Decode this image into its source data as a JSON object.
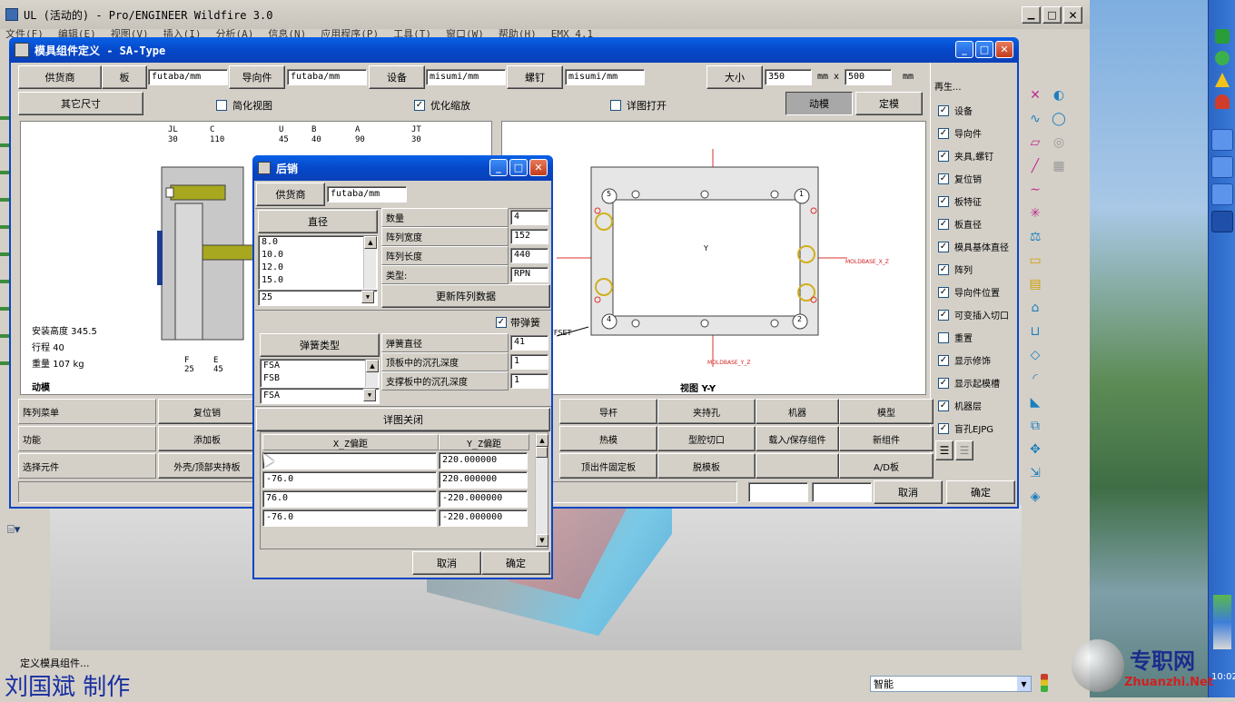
{
  "app": {
    "title": "UL (活动的) - Pro/ENGINEER Wildfire 3.0",
    "menu": [
      "文件(F)",
      "编辑(E)",
      "视图(V)",
      "插入(I)",
      "分析(A)",
      "信息(N)",
      "应用程序(P)",
      "工具(T)",
      "窗口(W)",
      "帮助(H)",
      "EMX 4.1"
    ],
    "status": "定义模具组件...",
    "smart": "智能"
  },
  "watermark": {
    "author": "刘国斌 制作",
    "site_cn": "专职网",
    "site_en": "Zhuanzhi.Net",
    "clock": "10:02"
  },
  "mold_dialog": {
    "title": "模具组件定义 - SA-Type",
    "row1": {
      "supplier_btn": "供货商",
      "plate_btn": "板",
      "plate_val": "futaba/mm",
      "guide_btn": "导向件",
      "guide_val": "futaba/mm",
      "equip_btn": "设备",
      "equip_val": "misumi/mm",
      "screw_btn": "螺钉",
      "screw_val": "misumi/mm",
      "size_btn": "大小",
      "size_w": "350",
      "mm_x": "mm x",
      "size_h": "500",
      "mm": "mm"
    },
    "row2": {
      "other_btn": "其它尺寸",
      "simplified": "简化视图",
      "optimize": "优化缩放",
      "detail_open": "详图打开",
      "moving_btn": "动模",
      "fixed_btn": "定模"
    },
    "left_view": {
      "labels_top": [
        "JL",
        "C",
        "U",
        "B",
        "A",
        "JT"
      ],
      "values_top": [
        "30",
        "110",
        "45",
        "40",
        "90",
        "30"
      ],
      "install_h": "安装高度  345.5",
      "stroke": "行程  40",
      "weight": "重量  107 kg",
      "bot_labels": [
        "F",
        "E"
      ],
      "bot_values": [
        "25",
        "45"
      ],
      "caption": "动模"
    },
    "right_view": {
      "caption": "视图 Y-Y",
      "xlabel": "MOLDBASE_X_Z",
      "ylabel": "MOLDBASE_Y_Z",
      "offset": "OFFSET",
      "circles": [
        "5",
        "1",
        "4",
        "2"
      ]
    },
    "regen": {
      "title": "再生...",
      "items": [
        {
          "label": "设备",
          "checked": true
        },
        {
          "label": "导向件",
          "checked": true
        },
        {
          "label": "夹具,螺钉",
          "checked": true
        },
        {
          "label": "复位销",
          "checked": true
        },
        {
          "label": "板特征",
          "checked": true
        },
        {
          "label": "板直径",
          "checked": true
        },
        {
          "label": "模具基体直径",
          "checked": true
        },
        {
          "label": "阵列",
          "checked": true
        },
        {
          "label": "导向件位置",
          "checked": true
        },
        {
          "label": "可变插入切口",
          "checked": true
        },
        {
          "label": "重置",
          "checked": false
        },
        {
          "label": "显示修饰",
          "checked": true
        },
        {
          "label": "显示起模槽",
          "checked": true
        },
        {
          "label": "机器层",
          "checked": true
        },
        {
          "label": "盲孔EJPG",
          "checked": true
        }
      ]
    },
    "bottom": {
      "r1_label": "阵列菜单",
      "r1": [
        "复位销",
        "导杆",
        "夹持孔",
        "机器",
        "模型"
      ],
      "r2_label": "功能",
      "r2": [
        "添加板",
        "热模",
        "型腔切口",
        "载入/保存组件",
        "新组件"
      ],
      "r3_label": "选择元件",
      "r3": [
        "外壳/顶部夹持板",
        "顶出件固定板",
        "脱模板",
        "",
        "A/D板"
      ],
      "cancel": "取消",
      "ok": "确定"
    }
  },
  "pin_dialog": {
    "title": "后销",
    "supplier_btn": "供货商",
    "supplier_val": "futaba/mm",
    "diam_btn": "直径",
    "diam_list": [
      "8.0",
      "10.0",
      "12.0",
      "15.0"
    ],
    "diam_val": "25",
    "fields": [
      {
        "label": "数量",
        "value": "4"
      },
      {
        "label": "阵列宽度",
        "value": "152"
      },
      {
        "label": "阵列长度",
        "value": "440"
      },
      {
        "label": "类型:",
        "value": "RPN"
      }
    ],
    "update_btn": "更新阵列数据",
    "with_spring": "带弹簧",
    "spring_type_btn": "弹簧类型",
    "spring_list": [
      "FSA",
      "FSB"
    ],
    "spring_val": "FSA",
    "spring_fields": [
      {
        "label": "弹簧直径",
        "value": "41"
      },
      {
        "label": "顶板中的沉孔深度",
        "value": "1"
      },
      {
        "label": "支撑板中的沉孔深度",
        "value": "1"
      }
    ],
    "detail_close": "详图关闭",
    "table": {
      "headers": [
        "X_Z偏距",
        "Y_Z偏距"
      ],
      "rows": [
        [
          "",
          "220.000000"
        ],
        [
          "-76.0",
          "220.000000"
        ],
        [
          "76.0",
          "-220.000000"
        ],
        [
          "-76.0",
          "-220.000000"
        ]
      ]
    },
    "cancel": "取消",
    "ok": "确定"
  }
}
